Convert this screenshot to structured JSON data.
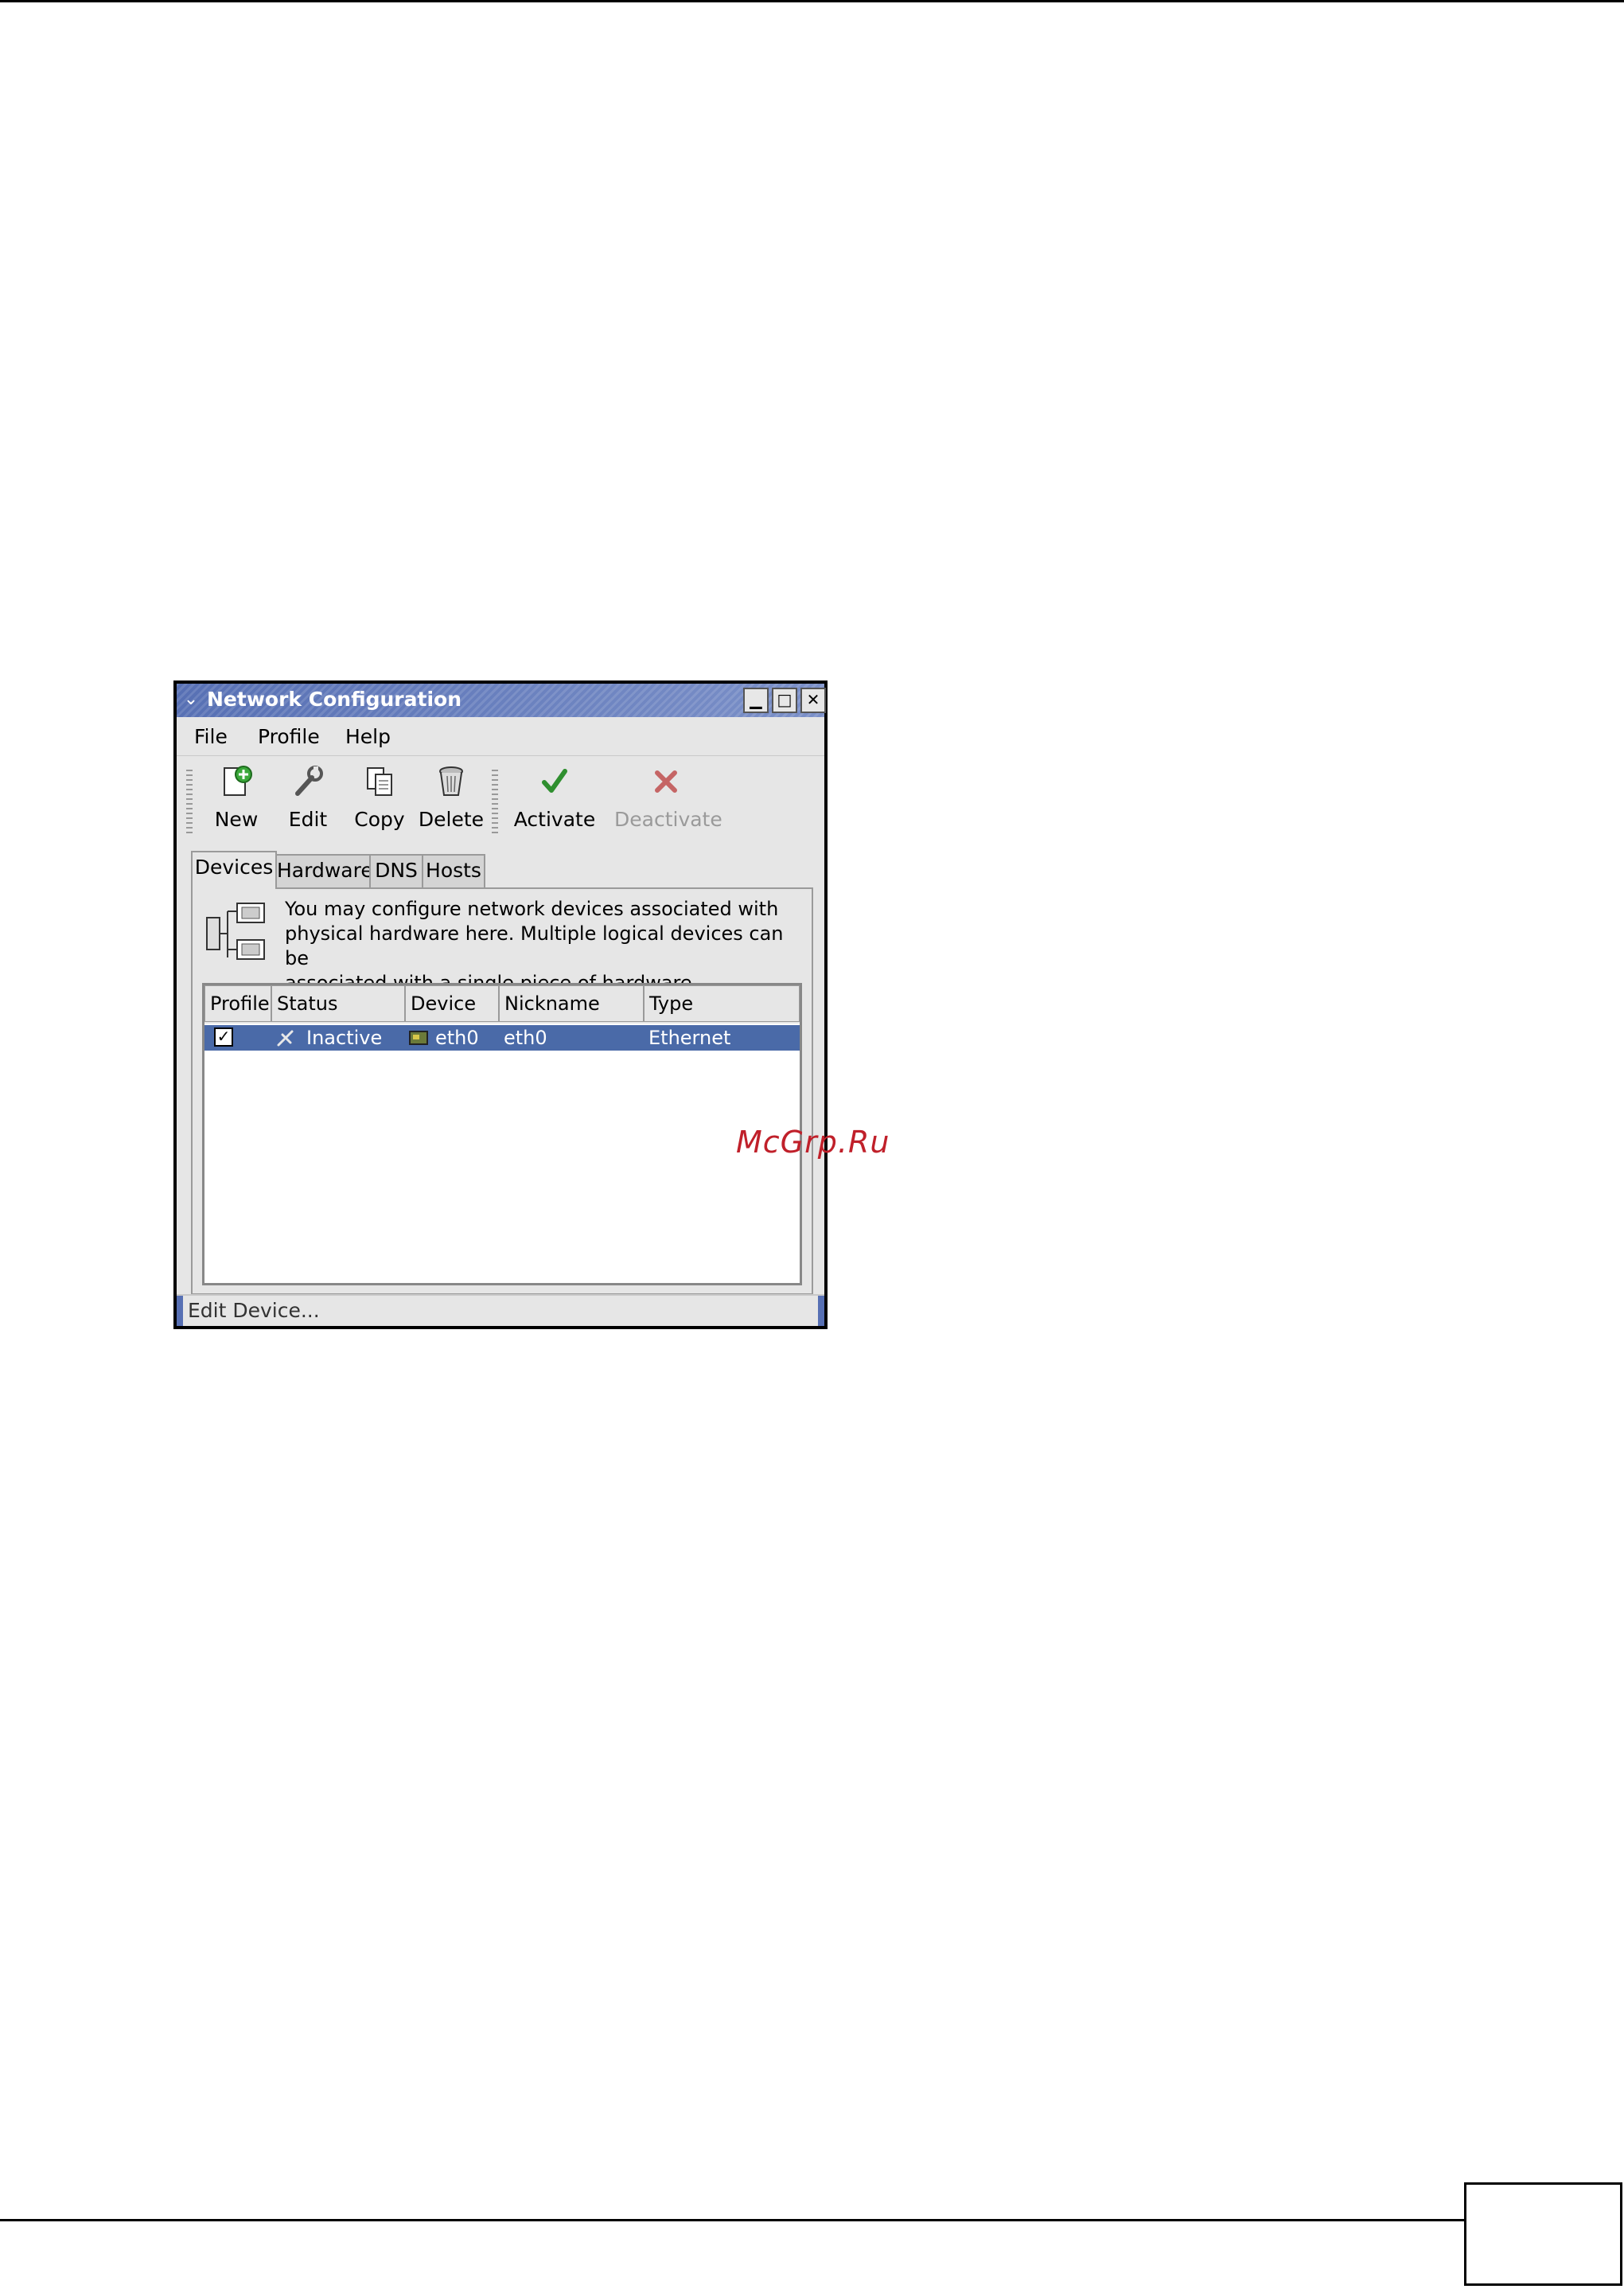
{
  "window": {
    "title": "Network Configuration"
  },
  "menu": {
    "file": "File",
    "profile": "Profile",
    "help": "Help"
  },
  "toolbar": {
    "new_label": "New",
    "edit_label": "Edit",
    "copy_label": "Copy",
    "delete_label": "Delete",
    "activate_label": "Activate",
    "deactivate_label": "Deactivate"
  },
  "tabs": [
    "Devices",
    "Hardware",
    "DNS",
    "Hosts"
  ],
  "panel": {
    "description": "You may configure network devices associated with\nphysical hardware here.  Multiple logical devices can be\nassociated with a single piece of hardware."
  },
  "table": {
    "columns": [
      "Profile",
      "Status",
      "Device",
      "Nickname",
      "Type"
    ],
    "rows": [
      {
        "profile_checked": true,
        "status": "Inactive",
        "device": "eth0",
        "nickname": "eth0",
        "type": "Ethernet"
      }
    ]
  },
  "statusbar": {
    "text": "Edit Device..."
  },
  "watermark": "McGrp.Ru",
  "colors": {
    "titlebar": "#5770b4",
    "selection": "#4a6aa8",
    "window_bg": "#e6e6e6",
    "watermark": "#c0202a"
  },
  "icons": [
    "window-menu-icon",
    "minimize-icon",
    "maximize-icon",
    "close-icon",
    "new-device-icon",
    "edit-wrench-icon",
    "copy-icon",
    "delete-trash-icon",
    "activate-check-icon",
    "deactivate-x-icon",
    "network-devices-icon",
    "inactive-status-icon",
    "ethernet-card-icon"
  ]
}
